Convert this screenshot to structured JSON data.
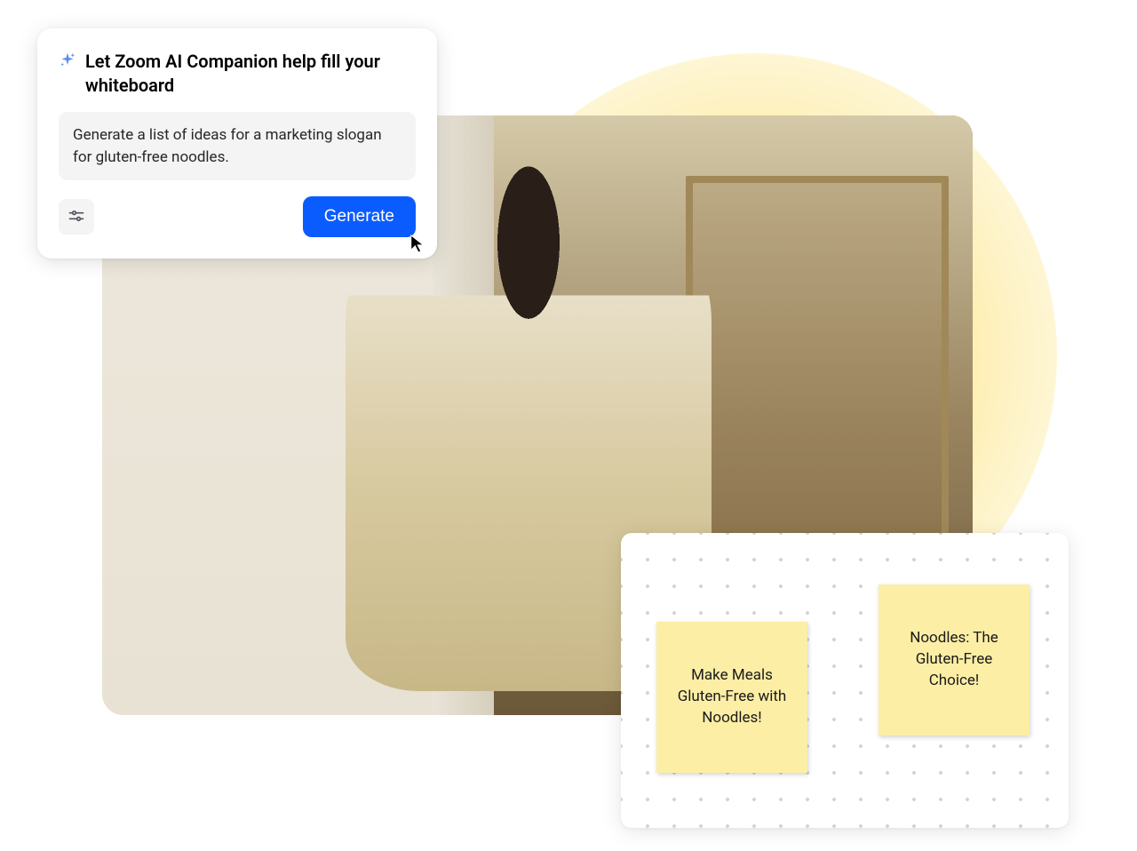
{
  "ai_panel": {
    "title": "Let Zoom AI Companion help fill your whiteboard",
    "prompt": "Generate a list of ideas for a marketing slogan for gluten-free noodles.",
    "generate_label": "Generate"
  },
  "whiteboard": {
    "sticky_notes": [
      "Make Meals Gluten-Free with Noodles!",
      "Noodles: The Gluten-Free Choice!"
    ]
  },
  "colors": {
    "primary_button": "#0b5cff",
    "sticky_note": "#fdeea6",
    "panel_bg": "#ffffff",
    "input_bg": "#f4f4f5"
  }
}
